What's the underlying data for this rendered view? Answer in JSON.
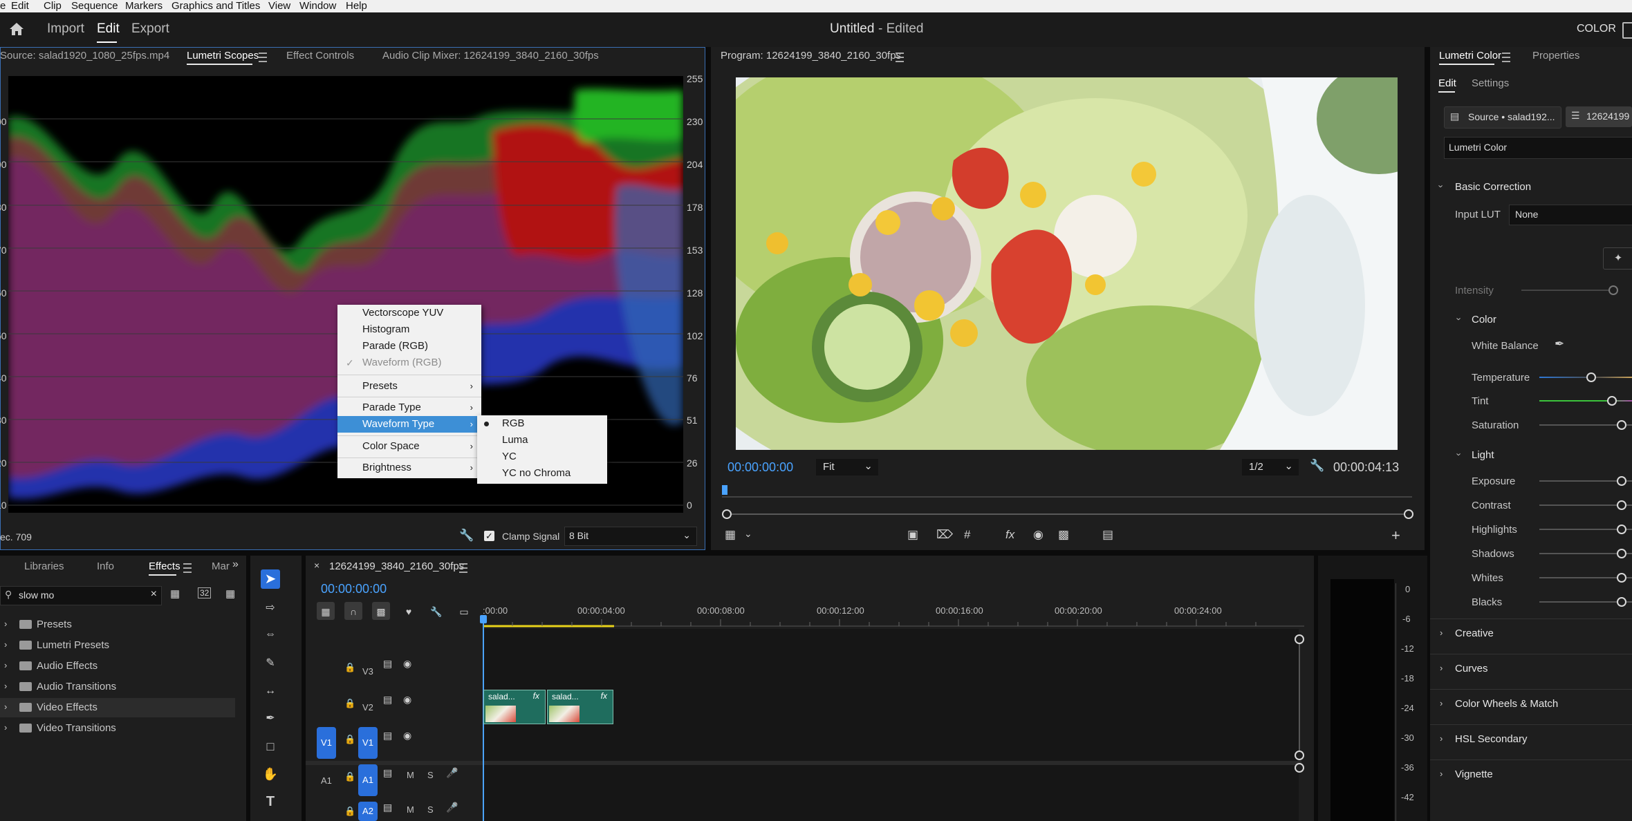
{
  "menubar": {
    "items": [
      "e",
      "Edit",
      "Clip",
      "Sequence",
      "Markers",
      "Graphics and Titles",
      "View",
      "Window",
      "Help"
    ]
  },
  "header": {
    "nav": [
      "Import",
      "Edit",
      "Export"
    ],
    "title": "Untitled",
    "title_suffix": "- Edited",
    "workspace": "COLOR"
  },
  "source_panel": {
    "tabs": [
      "Source: salad1920_1080_25fps.mp4",
      "Lumetri Scopes",
      "Effect Controls",
      "Audio Clip Mixer: 12624199_3840_2160_30fps"
    ],
    "scale": [
      "255",
      "230",
      "204",
      "178",
      "153",
      "128",
      "102",
      "76",
      "51",
      "26",
      "0"
    ],
    "left_scale": [
      "00",
      "90",
      "80",
      "70",
      "60",
      "50",
      "40",
      "30",
      "20",
      "10",
      "0"
    ],
    "bottom_left": "ec. 709",
    "clamp_label": "Clamp Signal",
    "bit_depth": "8 Bit"
  },
  "context_menu": {
    "items": [
      "Vectorscope YUV",
      "Histogram",
      "Parade (RGB)",
      "Waveform (RGB)",
      "Presets",
      "Parade Type",
      "Waveform Type",
      "Color Space",
      "Brightness"
    ],
    "submenu": [
      "RGB",
      "Luma",
      "YC",
      "YC no Chroma"
    ]
  },
  "program": {
    "title": "Program: 12624199_3840_2160_30fps",
    "timecode": "00:00:00:00",
    "fit": "Fit",
    "resolution": "1/2",
    "duration": "00:00:04:13"
  },
  "effects_panel": {
    "tabs": [
      "Libraries",
      "Info",
      "Effects",
      "Mar"
    ],
    "search": "slow mo",
    "tree": [
      "Presets",
      "Lumetri Presets",
      "Audio Effects",
      "Audio Transitions",
      "Video Effects",
      "Video Transitions"
    ]
  },
  "timeline": {
    "sequence": "12624199_3840_2160_30fps",
    "timecode": "00:00:00:00",
    "ruler": [
      ":00:00",
      "00:00:04:00",
      "00:00:08:00",
      "00:00:12:00",
      "00:00:16:00",
      "00:00:20:00",
      "00:00:24:00"
    ],
    "tracks": [
      "V3",
      "V2",
      "V1",
      "A1",
      "A2"
    ],
    "clip_label": "salad..."
  },
  "meter_scale": [
    "0",
    "-6",
    "-12",
    "-18",
    "-24",
    "-30",
    "-36",
    "-42"
  ],
  "lumetri": {
    "tabs": [
      "Lumetri Color",
      "Properties"
    ],
    "subtabs": [
      "Edit",
      "Settings"
    ],
    "source_btn": "Source • salad192...",
    "seq_btn": "12624199",
    "effect_name": "Lumetri Color",
    "basic_correction": "Basic Correction",
    "input_lut_label": "Input LUT",
    "input_lut_value": "None",
    "intensity": "Intensity",
    "color_section": "Color",
    "white_balance": "White Balance",
    "color_props": [
      "Temperature",
      "Tint",
      "Saturation"
    ],
    "light_section": "Light",
    "light_props": [
      "Exposure",
      "Contrast",
      "Highlights",
      "Shadows",
      "Whites",
      "Blacks"
    ],
    "collapsed": [
      "Creative",
      "Curves",
      "Color Wheels & Match",
      "HSL Secondary",
      "Vignette"
    ]
  }
}
